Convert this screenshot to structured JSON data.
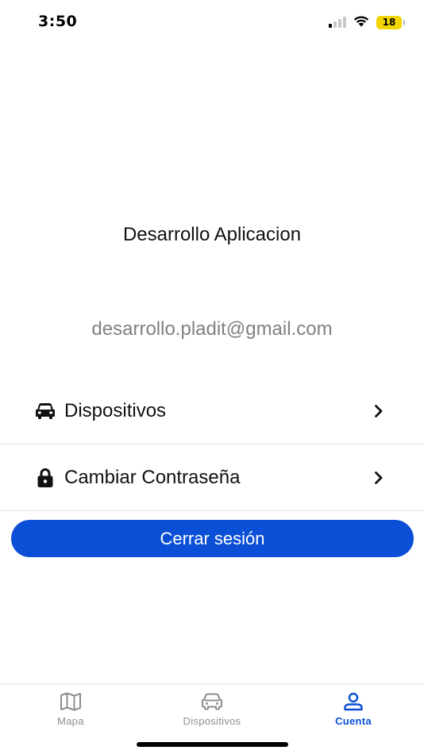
{
  "status_bar": {
    "time": "3:50",
    "battery_level": "18",
    "icons": [
      "signal-icon",
      "wifi-icon",
      "battery-icon"
    ]
  },
  "profile": {
    "name": "Desarrollo Aplicacion",
    "email": "desarrollo.pladit@gmail.com"
  },
  "menu": {
    "items": [
      {
        "label": "Dispositivos",
        "icon": "car-icon"
      },
      {
        "label": "Cambiar Contraseña",
        "icon": "lock-icon"
      }
    ]
  },
  "logout": {
    "label": "Cerrar sesión"
  },
  "tab_bar": {
    "tabs": [
      {
        "label": "Mapa",
        "icon": "map-icon",
        "active": false
      },
      {
        "label": "Dispositivos",
        "icon": "car-icon",
        "active": false
      },
      {
        "label": "Cuenta",
        "icon": "user-icon",
        "active": true
      }
    ]
  },
  "colors": {
    "accent": "#0a4fd6",
    "battery": "#f2d400",
    "inactive_tab": "#8e8e93",
    "email_text": "#808080"
  }
}
